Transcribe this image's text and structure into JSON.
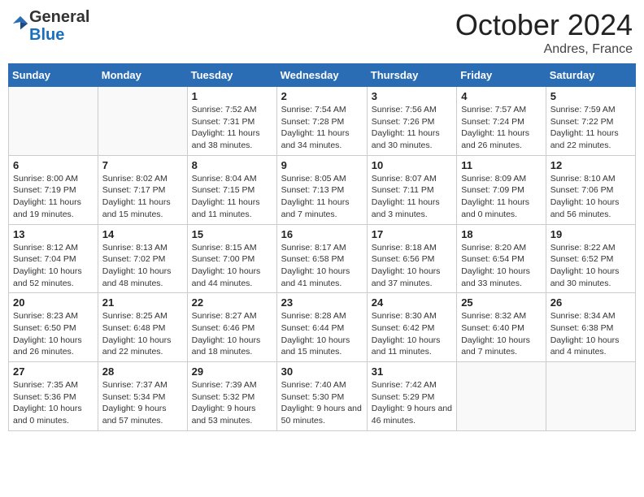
{
  "header": {
    "logo_general": "General",
    "logo_blue": "Blue",
    "month_title": "October 2024",
    "location": "Andres, France"
  },
  "days_of_week": [
    "Sunday",
    "Monday",
    "Tuesday",
    "Wednesday",
    "Thursday",
    "Friday",
    "Saturday"
  ],
  "weeks": [
    [
      {
        "day": "",
        "info": ""
      },
      {
        "day": "",
        "info": ""
      },
      {
        "day": "1",
        "sunrise": "7:52 AM",
        "sunset": "7:31 PM",
        "daylight": "11 hours and 38 minutes."
      },
      {
        "day": "2",
        "sunrise": "7:54 AM",
        "sunset": "7:28 PM",
        "daylight": "11 hours and 34 minutes."
      },
      {
        "day": "3",
        "sunrise": "7:56 AM",
        "sunset": "7:26 PM",
        "daylight": "11 hours and 30 minutes."
      },
      {
        "day": "4",
        "sunrise": "7:57 AM",
        "sunset": "7:24 PM",
        "daylight": "11 hours and 26 minutes."
      },
      {
        "day": "5",
        "sunrise": "7:59 AM",
        "sunset": "7:22 PM",
        "daylight": "11 hours and 22 minutes."
      }
    ],
    [
      {
        "day": "6",
        "sunrise": "8:00 AM",
        "sunset": "7:19 PM",
        "daylight": "11 hours and 19 minutes."
      },
      {
        "day": "7",
        "sunrise": "8:02 AM",
        "sunset": "7:17 PM",
        "daylight": "11 hours and 15 minutes."
      },
      {
        "day": "8",
        "sunrise": "8:04 AM",
        "sunset": "7:15 PM",
        "daylight": "11 hours and 11 minutes."
      },
      {
        "day": "9",
        "sunrise": "8:05 AM",
        "sunset": "7:13 PM",
        "daylight": "11 hours and 7 minutes."
      },
      {
        "day": "10",
        "sunrise": "8:07 AM",
        "sunset": "7:11 PM",
        "daylight": "11 hours and 3 minutes."
      },
      {
        "day": "11",
        "sunrise": "8:09 AM",
        "sunset": "7:09 PM",
        "daylight": "11 hours and 0 minutes."
      },
      {
        "day": "12",
        "sunrise": "8:10 AM",
        "sunset": "7:06 PM",
        "daylight": "10 hours and 56 minutes."
      }
    ],
    [
      {
        "day": "13",
        "sunrise": "8:12 AM",
        "sunset": "7:04 PM",
        "daylight": "10 hours and 52 minutes."
      },
      {
        "day": "14",
        "sunrise": "8:13 AM",
        "sunset": "7:02 PM",
        "daylight": "10 hours and 48 minutes."
      },
      {
        "day": "15",
        "sunrise": "8:15 AM",
        "sunset": "7:00 PM",
        "daylight": "10 hours and 44 minutes."
      },
      {
        "day": "16",
        "sunrise": "8:17 AM",
        "sunset": "6:58 PM",
        "daylight": "10 hours and 41 minutes."
      },
      {
        "day": "17",
        "sunrise": "8:18 AM",
        "sunset": "6:56 PM",
        "daylight": "10 hours and 37 minutes."
      },
      {
        "day": "18",
        "sunrise": "8:20 AM",
        "sunset": "6:54 PM",
        "daylight": "10 hours and 33 minutes."
      },
      {
        "day": "19",
        "sunrise": "8:22 AM",
        "sunset": "6:52 PM",
        "daylight": "10 hours and 30 minutes."
      }
    ],
    [
      {
        "day": "20",
        "sunrise": "8:23 AM",
        "sunset": "6:50 PM",
        "daylight": "10 hours and 26 minutes."
      },
      {
        "day": "21",
        "sunrise": "8:25 AM",
        "sunset": "6:48 PM",
        "daylight": "10 hours and 22 minutes."
      },
      {
        "day": "22",
        "sunrise": "8:27 AM",
        "sunset": "6:46 PM",
        "daylight": "10 hours and 18 minutes."
      },
      {
        "day": "23",
        "sunrise": "8:28 AM",
        "sunset": "6:44 PM",
        "daylight": "10 hours and 15 minutes."
      },
      {
        "day": "24",
        "sunrise": "8:30 AM",
        "sunset": "6:42 PM",
        "daylight": "10 hours and 11 minutes."
      },
      {
        "day": "25",
        "sunrise": "8:32 AM",
        "sunset": "6:40 PM",
        "daylight": "10 hours and 7 minutes."
      },
      {
        "day": "26",
        "sunrise": "8:34 AM",
        "sunset": "6:38 PM",
        "daylight": "10 hours and 4 minutes."
      }
    ],
    [
      {
        "day": "27",
        "sunrise": "7:35 AM",
        "sunset": "5:36 PM",
        "daylight": "10 hours and 0 minutes."
      },
      {
        "day": "28",
        "sunrise": "7:37 AM",
        "sunset": "5:34 PM",
        "daylight": "9 hours and 57 minutes."
      },
      {
        "day": "29",
        "sunrise": "7:39 AM",
        "sunset": "5:32 PM",
        "daylight": "9 hours and 53 minutes."
      },
      {
        "day": "30",
        "sunrise": "7:40 AM",
        "sunset": "5:30 PM",
        "daylight": "9 hours and 50 minutes."
      },
      {
        "day": "31",
        "sunrise": "7:42 AM",
        "sunset": "5:29 PM",
        "daylight": "9 hours and 46 minutes."
      },
      {
        "day": "",
        "info": ""
      },
      {
        "day": "",
        "info": ""
      }
    ]
  ]
}
